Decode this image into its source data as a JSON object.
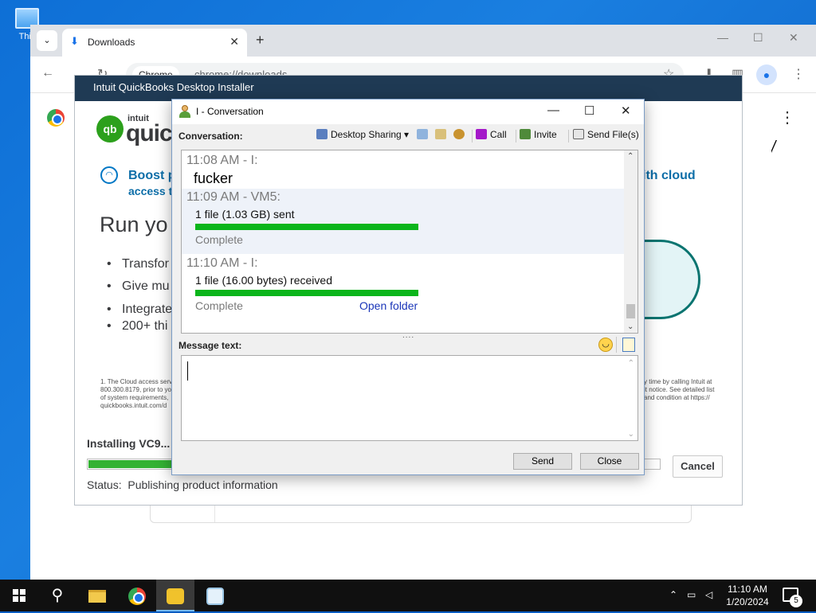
{
  "desktop": {
    "icon_label": "This"
  },
  "browser": {
    "tab_title": "Downloads",
    "omnibox_chip": "Chrome",
    "omnibox_url": "chrome://downloads"
  },
  "installer": {
    "window_title": "Intuit QuickBooks Desktop Installer",
    "logo_mark": "qb",
    "brand_top": "intuit",
    "brand_bottom": "quick",
    "boost_line1": "Boost p",
    "boost_line2": "access t",
    "boost_right": "ith cloud",
    "heading": "Run yo",
    "bullets": [
      "Transfor",
      "Give mu",
      "Integrate",
      "200+ thi"
    ],
    "footnote_left": "1. The Cloud access serv\n800.300.8179, prior to yo\nof system requirements,\nquickbooks.intuit.com/d",
    "footnote_right": "y time by calling Intuit at\nit notice. See detailed list\nand condition at https://",
    "installing_label": "Installing VC9...",
    "progress": 0.15,
    "status_label": "Status:",
    "status_value": "Publishing product information",
    "cancel_label": "Cancel"
  },
  "conversation": {
    "window_title": "I - Conversation",
    "conversation_label": "Conversation:",
    "toolbar": {
      "desktop_sharing": "Desktop Sharing",
      "call": "Call",
      "invite": "Invite",
      "send_files": "Send File(s)"
    },
    "messages": [
      {
        "header": "11:08 AM - I:",
        "text": "fucker"
      },
      {
        "header": "11:09 AM - VM5:",
        "file_line": "1 file (1.03 GB) sent",
        "status": "Complete",
        "progress": 1.0
      },
      {
        "header": "11:10 AM - I:",
        "file_line": "1 file (16.00 bytes) received",
        "status": "Complete",
        "link": "Open folder",
        "progress": 1.0
      }
    ],
    "splitter": "....",
    "message_text_label": "Message text:",
    "send_label": "Send",
    "close_label": "Close"
  },
  "taskbar": {
    "time": "11:10 AM",
    "date": "1/20/2024",
    "notification_count": "5"
  },
  "colors": {
    "installer_title_bg": "#1f3a54",
    "progress_green": "#0bb51b",
    "link_blue": "#1a35b8",
    "qb_green": "#2ca01c"
  }
}
